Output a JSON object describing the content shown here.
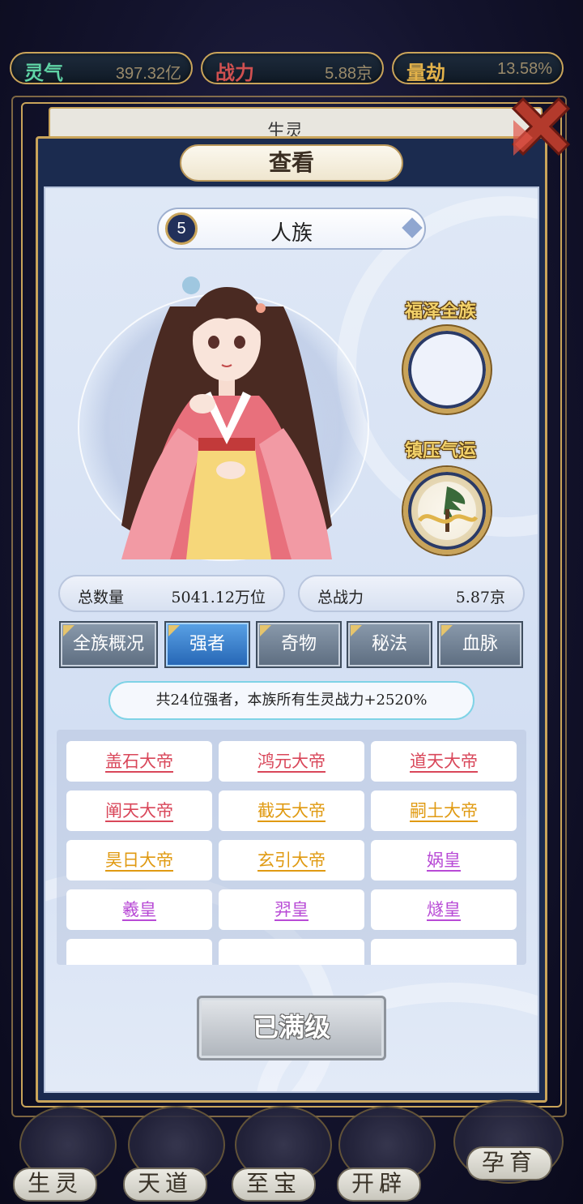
{
  "resources": [
    {
      "name": "灵气",
      "value": "397.32亿",
      "color": "#5fd3a5"
    },
    {
      "name": "战力",
      "value": "5.88京",
      "color": "#d05050"
    },
    {
      "name": "量劫",
      "value": "13.58%",
      "color": "#e3b24a"
    }
  ],
  "window": {
    "behind_title": "生灵",
    "title": "查看",
    "close_icon": "close-x-icon"
  },
  "race": {
    "number": "5",
    "name": "人族"
  },
  "side": {
    "blessing_label": "福泽全族",
    "suppress_label": "镇压气运"
  },
  "stats": {
    "total_count_label": "总数量",
    "total_count_value": "5041.12万位",
    "total_power_label": "总战力",
    "total_power_value": "5.87京"
  },
  "tabs": [
    "全族概况",
    "强者",
    "奇物",
    "秘法",
    "血脉"
  ],
  "active_tab": 1,
  "notice": "共24位强者，本族所有生灵战力+2520%",
  "heroes": [
    {
      "name": "盖石大帝",
      "color": "#d9475a"
    },
    {
      "name": "鸿元大帝",
      "color": "#d9475a"
    },
    {
      "name": "道天大帝",
      "color": "#d9475a"
    },
    {
      "name": "阐天大帝",
      "color": "#d9475a"
    },
    {
      "name": "截天大帝",
      "color": "#e09a12"
    },
    {
      "name": "嗣土大帝",
      "color": "#e09a12"
    },
    {
      "name": "昊日大帝",
      "color": "#e09a12"
    },
    {
      "name": "玄引大帝",
      "color": "#e09a12"
    },
    {
      "name": "娲皇",
      "color": "#b84ad6"
    },
    {
      "name": "羲皇",
      "color": "#b84ad6"
    },
    {
      "name": "羿皇",
      "color": "#b84ad6"
    },
    {
      "name": "燧皇",
      "color": "#b84ad6"
    }
  ],
  "max_button": "已满级",
  "nav": [
    "生灵",
    "天道",
    "至宝",
    "开辟",
    "孕育"
  ]
}
